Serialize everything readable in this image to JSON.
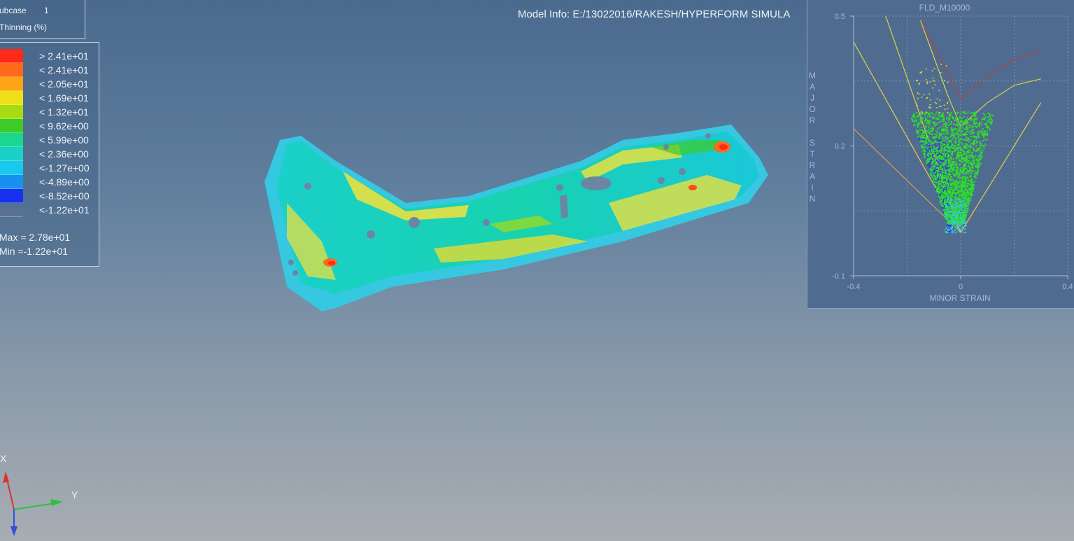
{
  "subcase": {
    "label": "ubcase",
    "value": "1",
    "result": "Thinning (%)"
  },
  "legend": {
    "entries": [
      {
        "label": "> 2.41e+01",
        "color": "#ff2a1a"
      },
      {
        "label": "< 2.41e+01",
        "color": "#ff6a1a"
      },
      {
        "label": "< 2.05e+01",
        "color": "#ffa414"
      },
      {
        "label": "< 1.69e+01",
        "color": "#f0e01a"
      },
      {
        "label": "< 1.32e+01",
        "color": "#a8dc12"
      },
      {
        "label": "< 9.62e+00",
        "color": "#3ccc28"
      },
      {
        "label": "< 5.99e+00",
        "color": "#18d890"
      },
      {
        "label": "< 2.36e+00",
        "color": "#1ad0c8"
      },
      {
        "label": "<-1.27e+00",
        "color": "#18c8ee"
      },
      {
        "label": "<-4.89e+00",
        "color": "#1890f0"
      },
      {
        "label": "<-8.52e+00",
        "color": "#1a30f0"
      },
      {
        "label": "<-1.22e+01",
        "color": "#5a7294"
      }
    ],
    "max": "Max = 2.78e+01",
    "min": "Min =-1.22e+01"
  },
  "model_info": "Model Info: E:/13022016/RAKESH/HYPERFORM SIMULA",
  "chart_data": {
    "type": "scatter",
    "title": "FLD_M10000",
    "xlabel": "MINOR STRAIN",
    "ylabel": "MAJOR STRAIN",
    "xlim": [
      -0.4,
      0.4
    ],
    "ylim": [
      -0.1,
      0.5
    ],
    "x_ticks": [
      "-0.4",
      "0",
      "0.4"
    ],
    "y_ticks": [
      "0.5",
      "0.2",
      "-0.1"
    ],
    "grid": true,
    "curves": [
      {
        "name": "forming-limit-curve",
        "color": "#b84040",
        "x": [
          -0.15,
          -0.05,
          0.0,
          0.1,
          0.2,
          0.3
        ],
        "y": [
          0.49,
          0.37,
          0.31,
          0.36,
          0.4,
          0.42
        ]
      },
      {
        "name": "safety-margin-curve",
        "color": "#e0d040",
        "x": [
          -0.15,
          -0.05,
          0.0,
          0.1,
          0.2,
          0.3
        ],
        "y": [
          0.49,
          0.32,
          0.245,
          0.3,
          0.34,
          0.355
        ]
      },
      {
        "name": "strain-line-left-a",
        "color": "#e0d040",
        "x": [
          -0.4,
          0.0
        ],
        "y": [
          0.44,
          0.0
        ]
      },
      {
        "name": "strain-line-left-b",
        "color": "#d4a040",
        "x": [
          -0.4,
          0.0
        ],
        "y": [
          0.24,
          0.0
        ]
      },
      {
        "name": "strain-line-left-c",
        "color": "#e0d040",
        "x": [
          -0.28,
          0.0
        ],
        "y": [
          0.5,
          0.0
        ]
      },
      {
        "name": "strain-line-right",
        "color": "#e0d040",
        "x": [
          0.0,
          0.3
        ],
        "y": [
          0.0,
          0.3
        ]
      }
    ],
    "series": [
      {
        "name": "safe",
        "color": "#2ce02a"
      },
      {
        "name": "marginal",
        "color": "#e6e63a"
      },
      {
        "name": "compression",
        "color": "#2a3ae8"
      },
      {
        "name": "low-strain",
        "color": "#35c8e0"
      }
    ]
  },
  "triad": {
    "x": "X",
    "y": "Y",
    "x_color": "#e03030",
    "y_color": "#30c040",
    "z_color": "#3050e0"
  }
}
